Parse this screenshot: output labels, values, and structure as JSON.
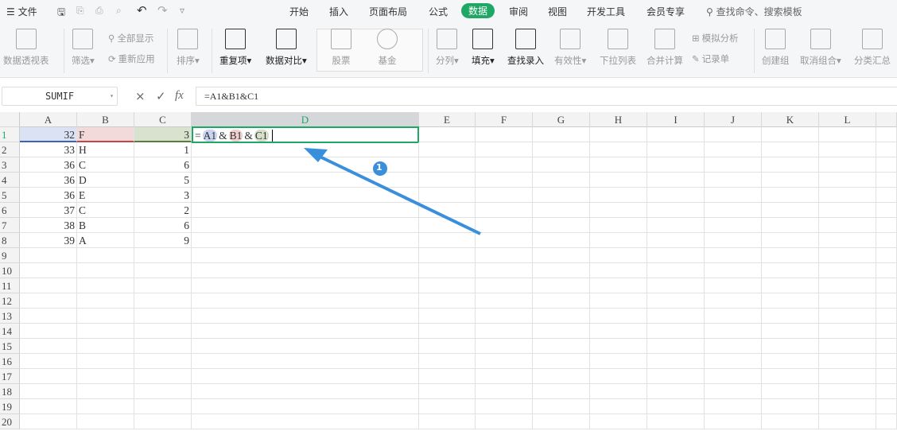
{
  "menubar": {
    "file": "文件",
    "tabs": [
      "开始",
      "插入",
      "页面布局",
      "公式",
      "数据",
      "审阅",
      "视图",
      "开发工具",
      "会员专享"
    ],
    "active_tab": "数据",
    "search": "查找命令、搜索模板"
  },
  "ribbon": {
    "pivot": "数据透视表",
    "filter": "筛选",
    "show_all": "全部显示",
    "reapply": "重新应用",
    "sort": "排序",
    "duplicates": "重复项",
    "compare": "数据对比",
    "stocks": "股票",
    "fund": "基金",
    "split": "分列",
    "fill": "填充",
    "lookup": "查找录入",
    "validity": "有效性",
    "dropdown": "下拉列表",
    "consolidate": "合并计算",
    "whatif": "模拟分析",
    "record": "记录单",
    "group": "创建组",
    "ungroup": "取消组合",
    "subtotal": "分类汇总"
  },
  "formula_bar": {
    "name_box": "SUMIF",
    "cancel": "×",
    "confirm": "✓",
    "fx": "fx",
    "formula": "=A1&B1&C1"
  },
  "columns": [
    "A",
    "B",
    "C",
    "D",
    "E",
    "F",
    "G",
    "H",
    "I",
    "J",
    "K",
    "L"
  ],
  "rows": [
    [
      "32",
      "F",
      "3"
    ],
    [
      "33",
      "H",
      "1"
    ],
    [
      "36",
      "C",
      "6"
    ],
    [
      "36",
      "D",
      "5"
    ],
    [
      "36",
      "E",
      "3"
    ],
    [
      "37",
      "C",
      "2"
    ],
    [
      "38",
      "B",
      "6"
    ],
    [
      "39",
      "A",
      "9"
    ]
  ],
  "row_count": 20,
  "editing": {
    "eq": "=",
    "r1": "A1",
    "amp1": "&",
    "r2": "B1",
    "amp2": "&",
    "r3": "C1"
  },
  "annotation": {
    "badge": "1"
  },
  "colors": {
    "accent": "#1fa865",
    "arrow": "#3a8fdc"
  }
}
